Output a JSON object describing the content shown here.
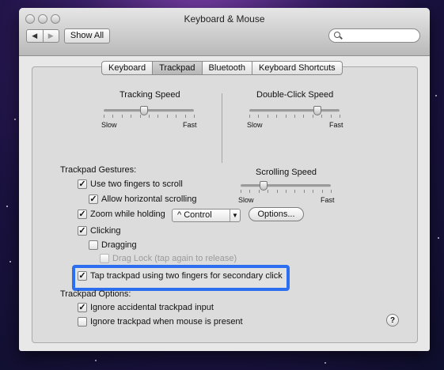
{
  "window": {
    "title": "Keyboard & Mouse",
    "nav_back": "◀",
    "nav_forward": "▶",
    "show_all": "Show All",
    "search_placeholder": ""
  },
  "tabs": [
    {
      "label": "Keyboard",
      "active": false
    },
    {
      "label": "Trackpad",
      "active": true
    },
    {
      "label": "Bluetooth",
      "active": false
    },
    {
      "label": "Keyboard Shortcuts",
      "active": false
    }
  ],
  "tracking_speed": {
    "label": "Tracking Speed",
    "min": "Slow",
    "max": "Fast",
    "value": 0.45
  },
  "double_click_speed": {
    "label": "Double-Click Speed",
    "min": "Slow",
    "max": "Fast",
    "value": 0.75
  },
  "scrolling_speed": {
    "label": "Scrolling Speed",
    "min": "Slow",
    "max": "Fast",
    "value": 0.25
  },
  "gestures": {
    "heading": "Trackpad Gestures:",
    "two_finger_scroll": {
      "label": "Use two fingers to scroll",
      "checked": true
    },
    "horizontal_scroll": {
      "label": "Allow horizontal scrolling",
      "checked": true
    },
    "zoom": {
      "label": "Zoom while holding",
      "checked": true,
      "modifier": "^ Control",
      "options_button": "Options..."
    },
    "clicking": {
      "label": "Clicking",
      "checked": true
    },
    "dragging": {
      "label": "Dragging",
      "checked": false
    },
    "drag_lock": {
      "label": "Drag Lock (tap again to release)",
      "checked": false,
      "enabled": false
    },
    "secondary_click": {
      "label": "Tap trackpad using two fingers for secondary click",
      "checked": true
    }
  },
  "options": {
    "heading": "Trackpad Options:",
    "ignore_accidental": {
      "label": "Ignore accidental trackpad input",
      "checked": true
    },
    "ignore_when_mouse": {
      "label": "Ignore trackpad when mouse is present",
      "checked": false
    }
  },
  "help": "?",
  "check_mark": "✓",
  "colors": {
    "highlight": "#2b6ef0",
    "desktop": "#3a1f68"
  }
}
